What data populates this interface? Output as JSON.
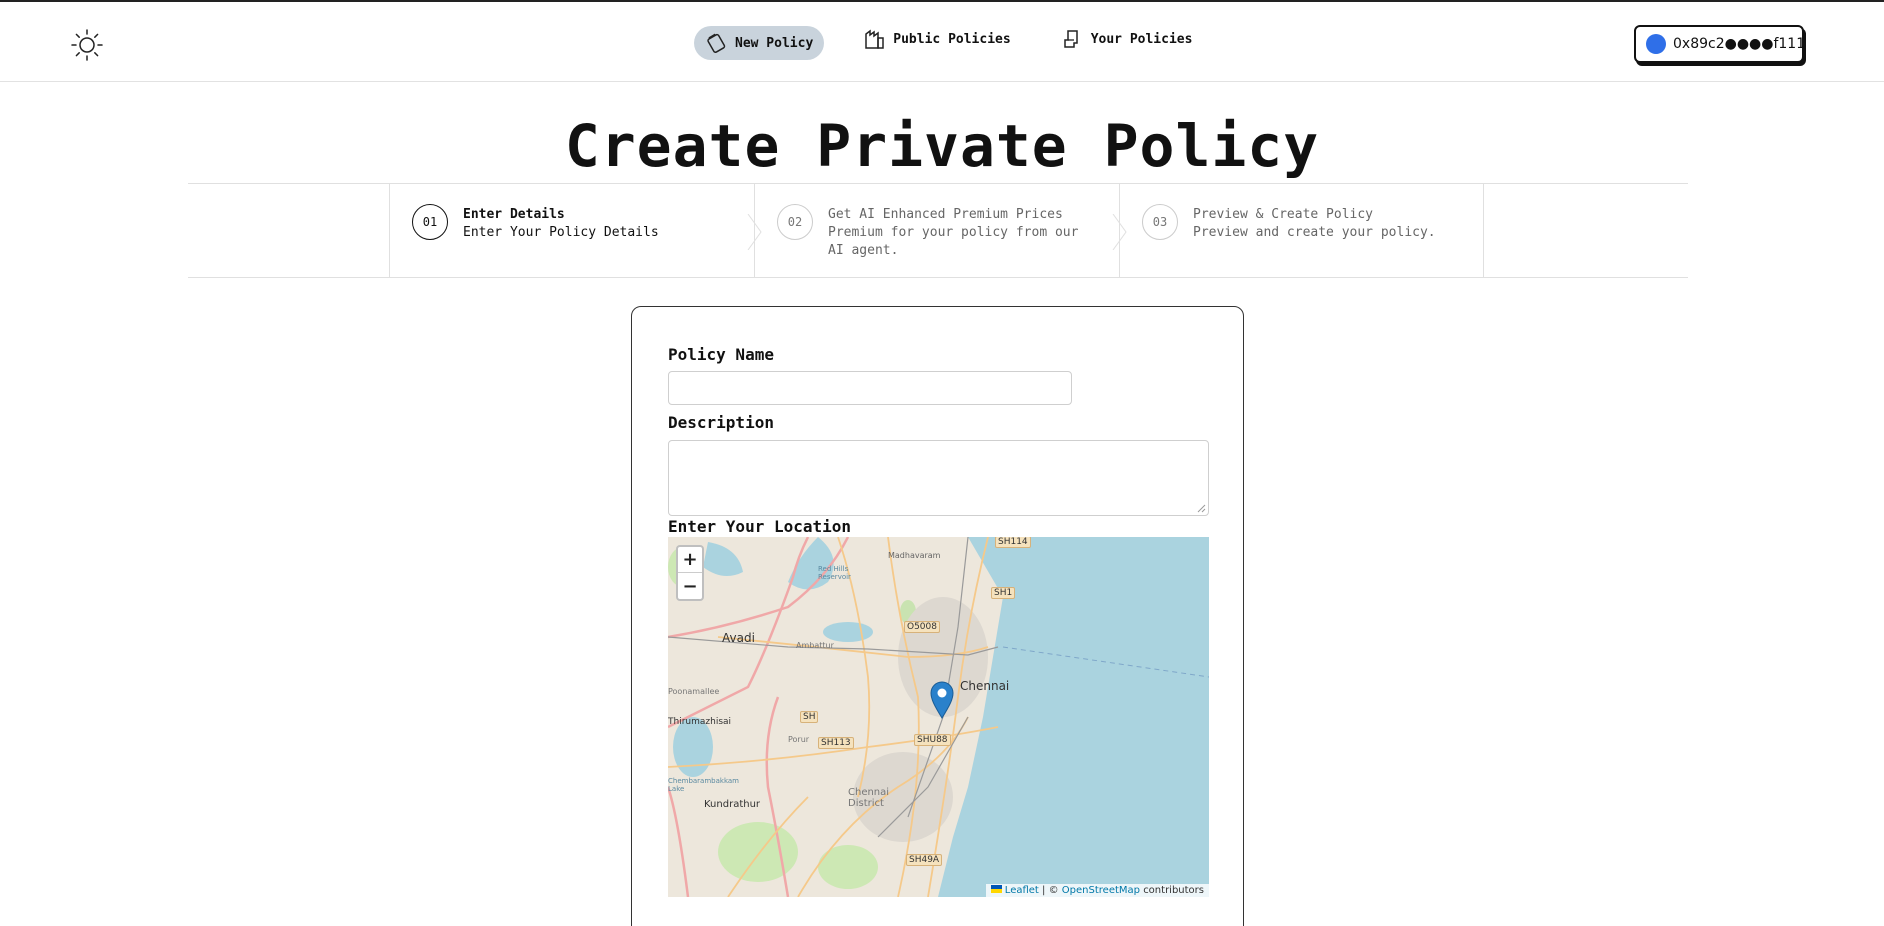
{
  "nav": {
    "items": [
      {
        "label": "New Policy",
        "active": true,
        "icon": "document-tilted-icon"
      },
      {
        "label": "Public Policies",
        "active": false,
        "icon": "building-icon"
      },
      {
        "label": "Your Policies",
        "active": false,
        "icon": "document-icon"
      }
    ]
  },
  "theme_toggle": {
    "icon": "sun-icon"
  },
  "wallet": {
    "address": "0x89c2●●●●f111",
    "accent": "#2f6fe8"
  },
  "page": {
    "title": "Create Private Policy"
  },
  "steps": [
    {
      "number": "01",
      "title": "Enter Details",
      "subtitle": "Enter Your Policy Details",
      "active": true
    },
    {
      "number": "02",
      "title": "Get AI Enhanced Premium Prices",
      "subtitle": "Premium for your policy from our AI agent.",
      "active": false
    },
    {
      "number": "03",
      "title": "Preview & Create Policy",
      "subtitle": "Preview and create your policy.",
      "active": false
    }
  ],
  "form": {
    "policy_name_label": "Policy Name",
    "policy_name_value": "",
    "description_label": "Description",
    "description_value": "",
    "location_label": "Enter Your Location"
  },
  "map": {
    "zoom_in": "+",
    "zoom_out": "−",
    "attribution": {
      "leaflet": "Leaflet",
      "separator": "| ©",
      "osm": "OpenStreetMap",
      "suffix": "contributors"
    },
    "places": [
      "Avadi",
      "Chennai",
      "Kundrathur",
      "Chennai District",
      "Red Hills Reservoir",
      "Madhavaram",
      "Ambattur",
      "Thirumazhisai",
      "Porur",
      "Poonamallee",
      "Chembarambakkam Lake"
    ],
    "roads": [
      "SH114",
      "SH1",
      "O5008",
      "SH113",
      "SHU88",
      "SH49A",
      "SH"
    ]
  }
}
